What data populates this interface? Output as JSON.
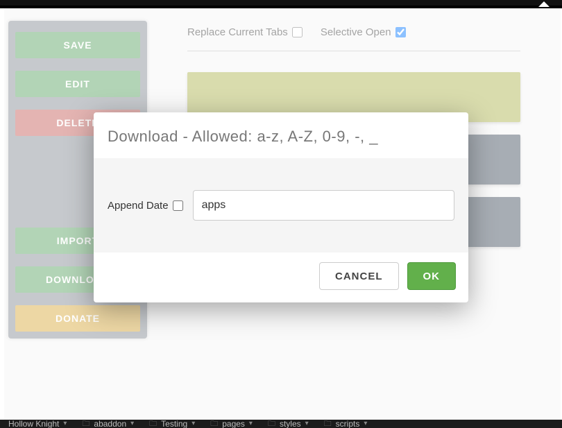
{
  "options": {
    "replace_tabs_label": "Replace Current Tabs",
    "replace_tabs_checked": false,
    "selective_open_label": "Selective Open",
    "selective_open_checked": true
  },
  "sidebar": {
    "save": "SAVE",
    "edit": "EDIT",
    "delete": "DELETE",
    "import": "IMPORT",
    "download": "DOWNLOAD",
    "donate": "DONATE"
  },
  "modal": {
    "title": "Download - Allowed: a-z, A-Z, 0-9, -, _",
    "append_date_label": "Append Date",
    "append_date_checked": false,
    "filename_value": "apps",
    "cancel": "CANCEL",
    "ok": "OK"
  },
  "tabs": [
    "Hollow Knight",
    "abaddon",
    "Testing",
    "pages",
    "styles",
    "scripts"
  ]
}
